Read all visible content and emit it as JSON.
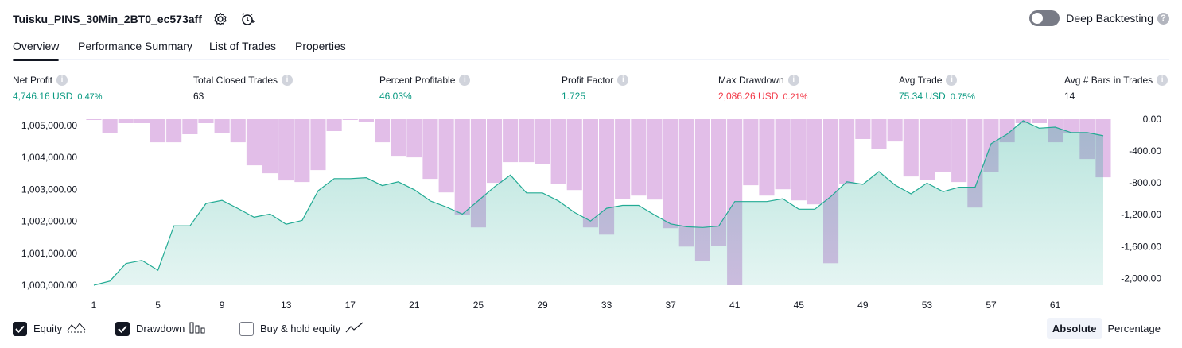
{
  "header": {
    "strategy_title": "Tuisku_PINS_30Min_2BT0_ec573aff",
    "deep_backtesting_label": "Deep Backtesting",
    "deep_backtesting_enabled": false
  },
  "tabs": [
    {
      "label": "Overview",
      "active": true
    },
    {
      "label": "Performance Summary",
      "active": false
    },
    {
      "label": "List of Trades",
      "active": false
    },
    {
      "label": "Properties",
      "active": false
    }
  ],
  "metrics": [
    {
      "label": "Net Profit",
      "value": "4,746.16 USD",
      "pct": "0.47%",
      "color": "#089981"
    },
    {
      "label": "Total Closed Trades",
      "value": "63",
      "pct": "",
      "color": "#131722"
    },
    {
      "label": "Percent Profitable",
      "value": "46.03%",
      "pct": "",
      "color": "#089981"
    },
    {
      "label": "Profit Factor",
      "value": "1.725",
      "pct": "",
      "color": "#089981"
    },
    {
      "label": "Max Drawdown",
      "value": "2,086.26 USD",
      "pct": "0.21%",
      "color": "#f23645"
    },
    {
      "label": "Avg Trade",
      "value": "75.34 USD",
      "pct": "0.75%",
      "color": "#089981"
    },
    {
      "label": "Avg # Bars in Trades",
      "value": "14",
      "pct": "",
      "color": "#131722"
    }
  ],
  "chart_data": {
    "type": "area",
    "x_ticks": [
      1,
      5,
      9,
      13,
      17,
      21,
      25,
      29,
      33,
      37,
      41,
      45,
      49,
      53,
      57,
      61
    ],
    "left_axis": {
      "ticks": [
        "1,005,000.00",
        "1,004,000.00",
        "1,003,000.00",
        "1,002,000.00",
        "1,001,000.00",
        "1,000,000.00"
      ],
      "range": [
        1000000,
        1005200
      ]
    },
    "right_axis": {
      "ticks": [
        "0.00",
        "-400.00",
        "-800.00",
        "-1,200.00",
        "-1,600.00",
        "-2,000.00"
      ],
      "range": [
        -2086.26,
        0
      ]
    },
    "x": [
      1,
      2,
      3,
      4,
      5,
      6,
      7,
      8,
      9,
      10,
      11,
      12,
      13,
      14,
      15,
      16,
      17,
      18,
      19,
      20,
      21,
      22,
      23,
      24,
      25,
      26,
      27,
      28,
      29,
      30,
      31,
      32,
      33,
      34,
      35,
      36,
      37,
      38,
      39,
      40,
      41,
      42,
      43,
      44,
      45,
      46,
      47,
      48,
      49,
      50,
      51,
      52,
      53,
      54,
      55,
      56,
      57,
      58,
      59,
      60,
      61,
      62,
      63,
      64
    ],
    "series": [
      {
        "name": "Equity",
        "color": "#22ab94",
        "values": [
          1000000,
          1000130,
          1000680,
          1000780,
          1000470,
          1001860,
          1001860,
          1002560,
          1002660,
          1002400,
          1002130,
          1002230,
          1001910,
          1002030,
          1002960,
          1003340,
          1003340,
          1003370,
          1003120,
          1003240,
          1002990,
          1002640,
          1002450,
          1002230,
          1002650,
          1003080,
          1003450,
          1002890,
          1002890,
          1002640,
          1002280,
          1002010,
          1002410,
          1002500,
          1002500,
          1002200,
          1001920,
          1001830,
          1001810,
          1001850,
          1002620,
          1002620,
          1002620,
          1002710,
          1002380,
          1002380,
          1002780,
          1003240,
          1003160,
          1003560,
          1003140,
          1002860,
          1003200,
          1002930,
          1003070,
          1003070,
          1004430,
          1004730,
          1005150,
          1004920,
          1004950,
          1004780,
          1004780,
          1004680
        ]
      },
      {
        "name": "Drawdown",
        "color": "#ce93d8",
        "values": [
          0,
          -180,
          -50,
          -50,
          -290,
          -290,
          -190,
          -50,
          -180,
          -290,
          -580,
          -680,
          -770,
          -790,
          -640,
          -150,
          0,
          -30,
          -290,
          -460,
          -480,
          -750,
          -920,
          -1200,
          -1360,
          -800,
          -540,
          -540,
          -560,
          -810,
          -890,
          -1360,
          -1450,
          -1000,
          -960,
          -1010,
          -1370,
          -1600,
          -1780,
          -1590,
          -2086,
          -830,
          -960,
          -880,
          -1020,
          -1070,
          -1810,
          -810,
          -250,
          -370,
          -280,
          -720,
          -760,
          -660,
          -790,
          -1110,
          -660,
          -290,
          -50,
          -50,
          -290,
          -170,
          -500,
          -730
        ]
      },
      {
        "name": "Buy & hold equity",
        "color": "#5d606b",
        "values": []
      }
    ]
  },
  "legend": [
    {
      "label": "Equity",
      "checked": true
    },
    {
      "label": "Drawdown",
      "checked": true
    },
    {
      "label": "Buy & hold equity",
      "checked": false
    }
  ],
  "modes": [
    {
      "label": "Absolute",
      "active": true
    },
    {
      "label": "Percentage",
      "active": false
    }
  ]
}
